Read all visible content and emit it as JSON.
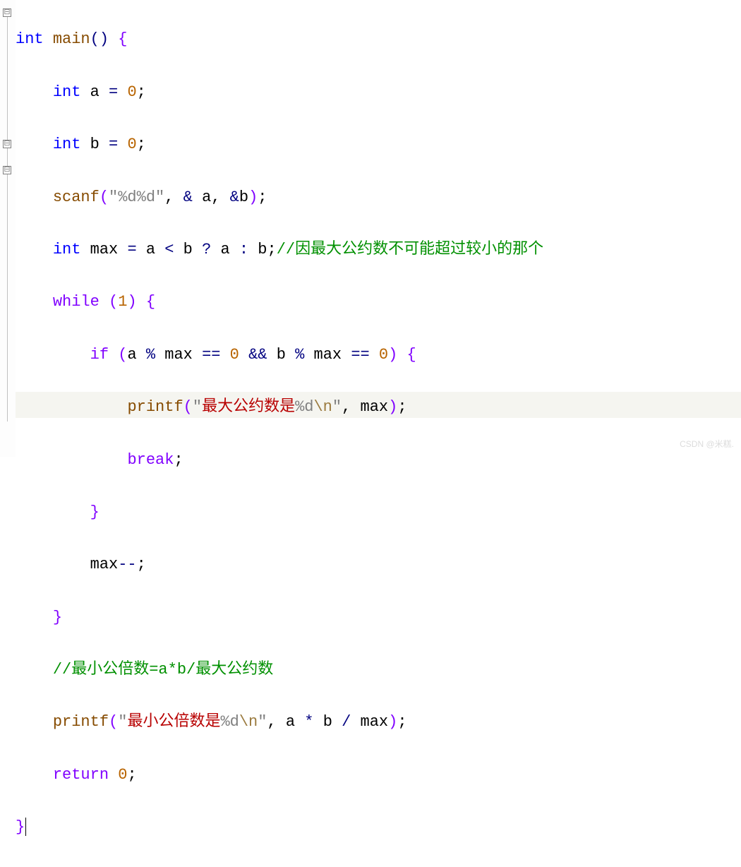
{
  "code": {
    "l1": {
      "kw": "int",
      "fn": "main",
      "op": "()",
      "brace": "{"
    },
    "l2": {
      "kw": "int",
      "var": "a",
      "eq": "=",
      "num": "0",
      "semi": ";"
    },
    "l3": {
      "kw": "int",
      "var": "b",
      "eq": "=",
      "num": "0",
      "semi": ";"
    },
    "l4": {
      "fn": "scanf",
      "lp": "(",
      "str": "\"%d%d\"",
      "comma1": ",",
      "amp1": "&",
      "v1": "a",
      "comma2": ",",
      "amp2": "&",
      "v2": "b",
      "rp": ")",
      "semi": ";"
    },
    "l5": {
      "kw": "int",
      "var": "max",
      "eq": "=",
      "a": "a",
      "lt": "<",
      "b": "b",
      "q": "?",
      "a2": "a",
      "colon": ":",
      "b2": "b",
      "semi": ";",
      "comment": "//因最大公约数不可能超过较小的那个"
    },
    "l6": {
      "kw": "while",
      "lp": "(",
      "num": "1",
      "rp": ")",
      "brace": "{"
    },
    "l7": {
      "kw": "if",
      "lp": "(",
      "a": "a",
      "mod1": "%",
      "max1": "max",
      "eq1": "==",
      "z1": "0",
      "and": "&&",
      "b": "b",
      "mod2": "%",
      "max2": "max",
      "eq2": "==",
      "z2": "0",
      "rp": ")",
      "brace": "{"
    },
    "l8": {
      "fn": "printf",
      "lp": "(",
      "q1": "\"",
      "zh": "最大公约数是",
      "fmt": "%d",
      "esc": "\\n",
      "q2": "\"",
      "comma": ",",
      "var": "max",
      "rp": ")",
      "semi": ";"
    },
    "l9": {
      "kw": "break",
      "semi": ";"
    },
    "l10": {
      "brace": "}"
    },
    "l11": {
      "var": "max",
      "op": "--",
      "semi": ";"
    },
    "l12": {
      "brace": "}"
    },
    "l13": {
      "comment": "//最小公倍数=a*b/最大公约数"
    },
    "l14": {
      "fn": "printf",
      "lp": "(",
      "q1": "\"",
      "zh": "最小公倍数是",
      "fmt": "%d",
      "esc": "\\n",
      "q2": "\"",
      "comma": ",",
      "a": "a",
      "mul": "*",
      "b": "b",
      "div": "/",
      "max": "max",
      "rp": ")",
      "semi": ";"
    },
    "l15": {
      "kw": "return",
      "num": "0",
      "semi": ";"
    },
    "l16": {
      "brace": "}"
    }
  },
  "fold": {
    "minus": "⊟"
  },
  "watermark": "CSDN @米糕."
}
